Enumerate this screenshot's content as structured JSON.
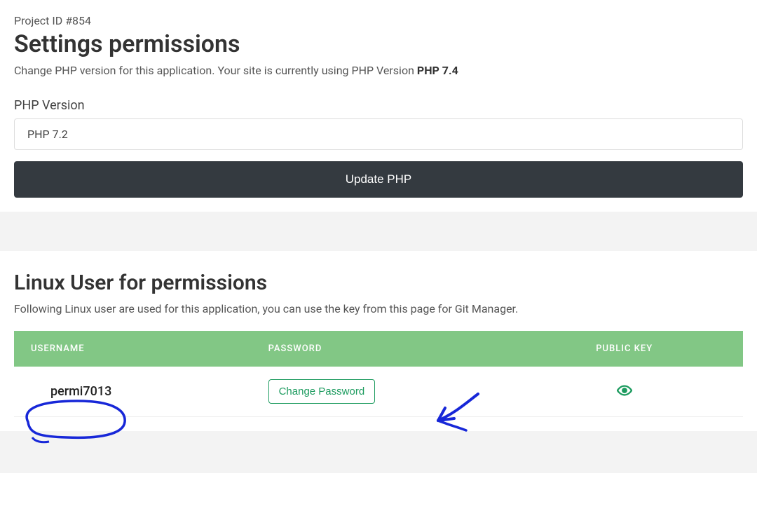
{
  "header": {
    "project_id_label": "Project ID #854",
    "title": "Settings permissions",
    "description_prefix": "Change PHP version for this application. Your site is currently using PHP Version ",
    "php_version_bold": "PHP 7.4"
  },
  "php_form": {
    "label": "PHP Version",
    "selected": "PHP 7.2",
    "button": "Update PHP"
  },
  "linux_section": {
    "title": "Linux User for permissions",
    "description": "Following Linux user are used for this application, you can use the key from this page for Git Manager.",
    "columns": {
      "username": "Username",
      "password": "Password",
      "public_key": "Public Key"
    },
    "rows": [
      {
        "username": "permi7013",
        "password_action": "Change Password"
      }
    ]
  }
}
